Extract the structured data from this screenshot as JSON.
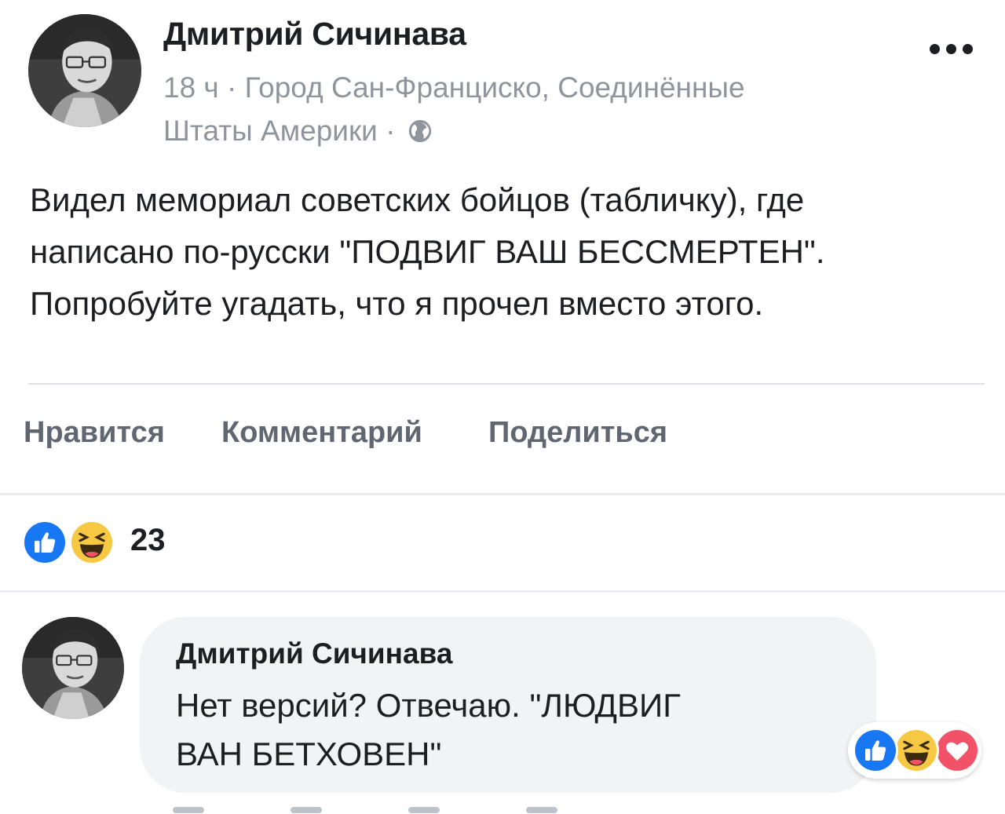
{
  "post": {
    "author": "Дмитрий Сичинава",
    "meta_line1": "18 ч · Город Сан-Франциско, Соединённые",
    "meta_line2": "Штаты Америки ·",
    "privacy_icon": "globe-icon",
    "more_icon": "ellipsis-icon",
    "text_line1": "Видел мемориал советских бойцов (табличку), где",
    "text_line2": "написано по-русски \"ПОДВИГ ВАШ БЕССМЕРТЕН\".",
    "text_line3": "Попробуйте угадать, что я прочел вместо этого."
  },
  "actions": {
    "like": "Нравится",
    "comment": "Комментарий",
    "share": "Поделиться"
  },
  "reactions": {
    "icons": [
      "like-reaction-icon",
      "haha-reaction-icon"
    ],
    "count": "23"
  },
  "comment": {
    "author": "Дмитрий Сичинава",
    "text_line1": "Нет версий? Отвечаю. \"ЛЮДВИГ",
    "text_line2": "ВАН БЕТХОВЕН\"",
    "reaction_icons": [
      "like-reaction-icon",
      "haha-reaction-icon",
      "love-reaction-icon"
    ]
  },
  "colors": {
    "like_blue": "#1877f2",
    "haha_yellow": "#f7c844",
    "love_red": "#f25268",
    "secondary_text": "#90949c",
    "action_text": "#606770"
  }
}
